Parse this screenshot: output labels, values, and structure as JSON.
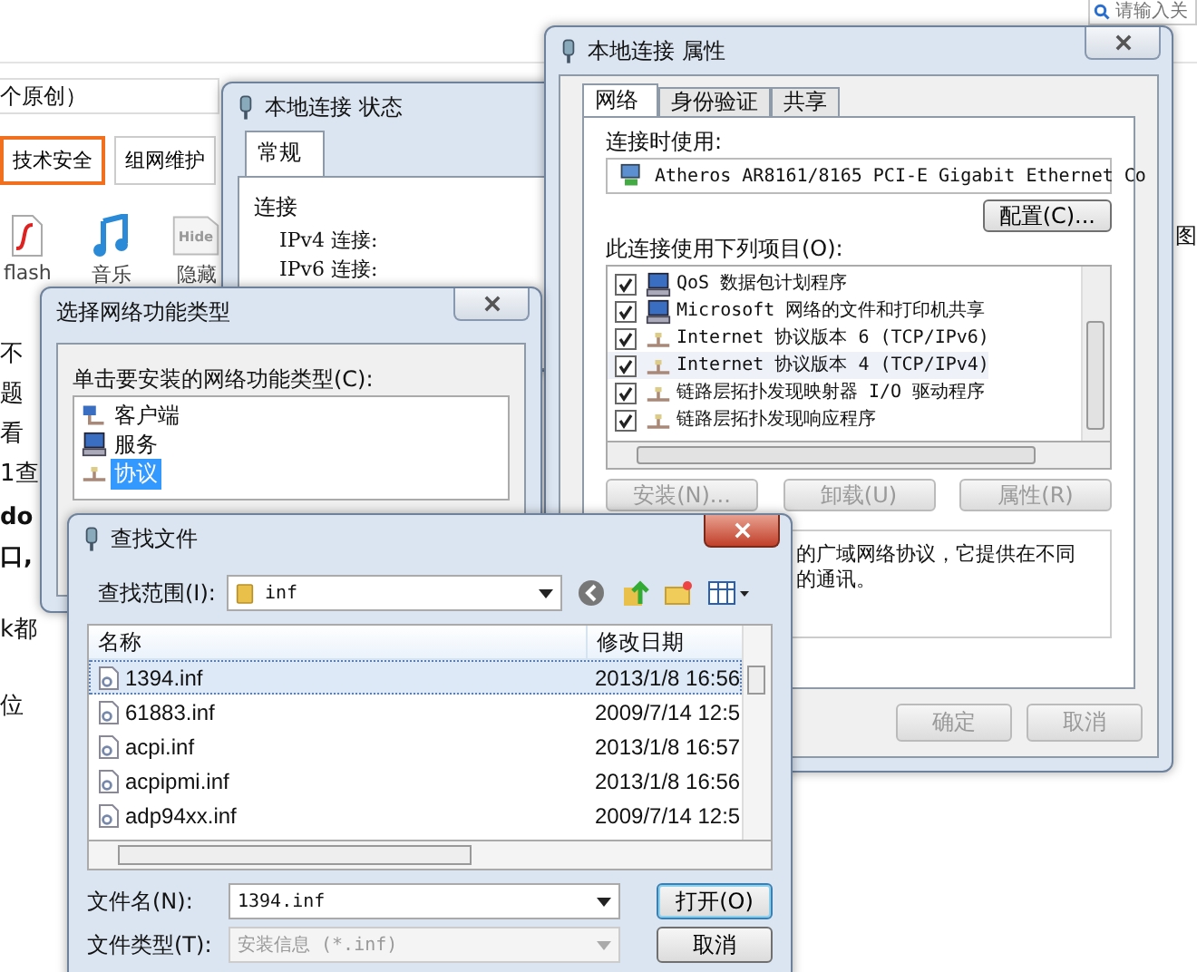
{
  "background_page": {
    "search": {
      "placeholder": "请输入关"
    },
    "heading_fragment": "个原创）",
    "tags": [
      {
        "label": "技术安全",
        "selected": true
      },
      {
        "label": "组网维护",
        "selected": false
      }
    ],
    "toolbar": [
      {
        "label": "flash",
        "kind": "flash"
      },
      {
        "label": "音乐",
        "kind": "music"
      },
      {
        "label": "隐藏",
        "kind": "hide",
        "icon_text": "Hide"
      }
    ],
    "text_fragments": [
      {
        "text": "不",
        "bold": false
      },
      {
        "text": "题",
        "bold": false
      },
      {
        "text": "看",
        "bold": false
      },
      {
        "text": "1查",
        "bold": false
      },
      {
        "text": "do",
        "bold": true
      },
      {
        "text": "口,",
        "bold": true
      },
      {
        "text": "k都",
        "bold": false
      },
      {
        "text": "位",
        "bold": false
      }
    ],
    "side_fragment": "图"
  },
  "status_window": {
    "title": "本地连接 状态",
    "tab": "常规",
    "section": "连接",
    "rows": [
      "IPv4 连接:",
      "IPv6 连接:"
    ]
  },
  "properties_window": {
    "title": "本地连接 属性",
    "tabs": [
      {
        "label": "网络",
        "selected": true
      },
      {
        "label": "身份验证",
        "selected": false
      },
      {
        "label": "共享",
        "selected": false
      }
    ],
    "connect_label": "连接时使用:",
    "adapter": "Atheros AR8161/8165 PCI-E Gigabit Ethernet Co",
    "configure_button": "配置(C)...",
    "items_label": "此连接使用下列项目(O):",
    "items": [
      {
        "label": "QoS 数据包计划程序",
        "checked": true,
        "selected": false,
        "kind": "service"
      },
      {
        "label": "Microsoft 网络的文件和打印机共享",
        "checked": true,
        "selected": false,
        "kind": "service"
      },
      {
        "label": "Internet 协议版本 6 (TCP/IPv6)",
        "checked": true,
        "selected": false,
        "kind": "protocol"
      },
      {
        "label": "Internet 协议版本 4 (TCP/IPv4)",
        "checked": true,
        "selected": true,
        "kind": "protocol"
      },
      {
        "label": "链路层拓扑发现映射器 I/O 驱动程序",
        "checked": true,
        "selected": false,
        "kind": "protocol"
      },
      {
        "label": "链路层拓扑发现响应程序",
        "checked": true,
        "selected": false,
        "kind": "protocol"
      }
    ],
    "item_buttons": [
      {
        "label": "安装(N)...",
        "disabled": true
      },
      {
        "label": "卸载(U)",
        "disabled": true
      },
      {
        "label": "属性(R)",
        "disabled": true
      }
    ],
    "description_lines": [
      "的广域网络协议，它提供在不同",
      "的通讯。"
    ],
    "dialog_buttons": [
      {
        "label": "确定",
        "disabled": true
      },
      {
        "label": "取消",
        "disabled": true
      }
    ]
  },
  "select_window": {
    "title": "选择网络功能类型",
    "prompt": "单击要安装的网络功能类型(C):",
    "options": [
      {
        "label": "客户端",
        "kind": "client",
        "selected": false
      },
      {
        "label": "服务",
        "kind": "service",
        "selected": false
      },
      {
        "label": "协议",
        "kind": "protocol",
        "selected": true
      }
    ]
  },
  "find_window": {
    "title": "查找文件",
    "look_in_label": "查找范围(I):",
    "folder": "inf",
    "columns": [
      "名称",
      "修改日期"
    ],
    "rows": [
      {
        "name": "1394.inf",
        "date": "2013/1/8 16:56",
        "selected": true
      },
      {
        "name": "61883.inf",
        "date": "2009/7/14 12:5",
        "selected": false
      },
      {
        "name": "acpi.inf",
        "date": "2013/1/8 16:57",
        "selected": false
      },
      {
        "name": "acpipmi.inf",
        "date": "2013/1/8 16:56",
        "selected": false
      },
      {
        "name": "adp94xx.inf",
        "date": "2009/7/14 12:5",
        "selected": false
      }
    ],
    "filename_label": "文件名(N):",
    "filename": "1394.inf",
    "filetype_label": "文件类型(T):",
    "filetype": "安装信息 (*.inf)",
    "open_button": "打开(O)",
    "cancel_button": "取消"
  }
}
